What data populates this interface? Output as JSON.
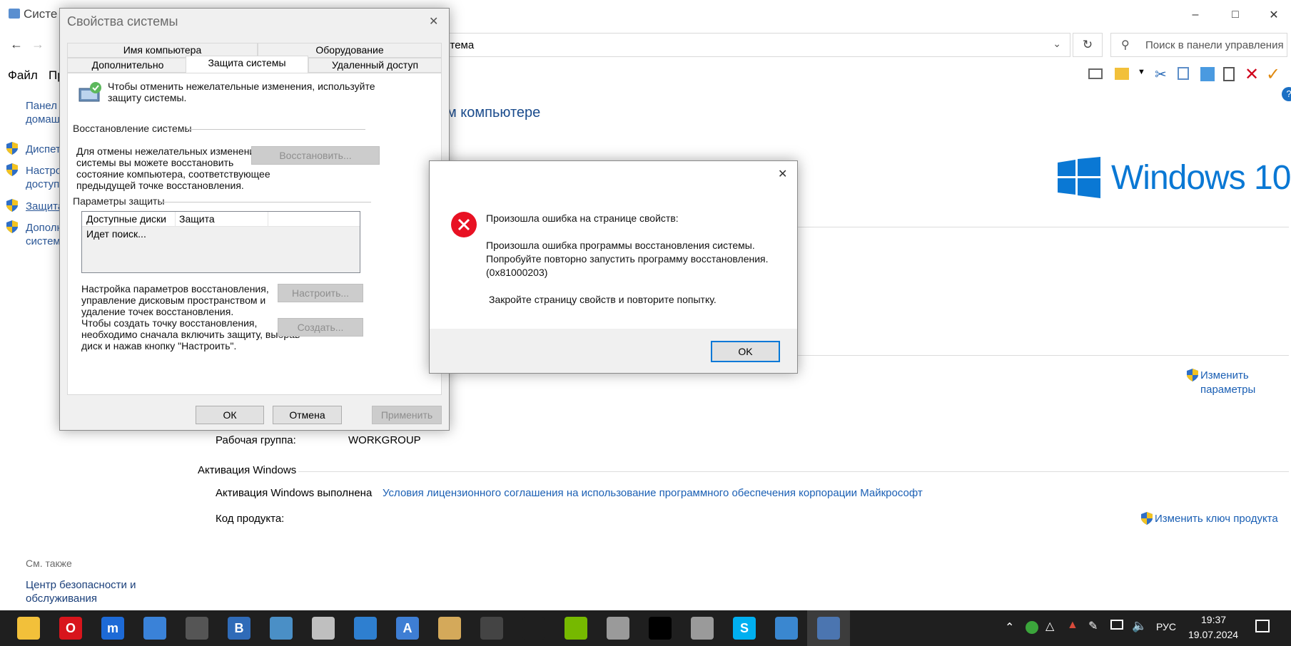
{
  "bgwin": {
    "title": "Систе",
    "address_text": "стема",
    "search_placeholder": "Поиск в панели управления",
    "menu": [
      "Файл",
      "Пр"
    ],
    "heading": "м компьютере",
    "sidebar": [
      {
        "label": "Панел\nдомаш",
        "shield": false
      },
      {
        "label": "Диспет",
        "shield": true
      },
      {
        "label": "Настро\nдоступа",
        "shield": true
      },
      {
        "label": "Защита",
        "shield": true,
        "underline": true
      },
      {
        "label": "Дополн\nсистем",
        "shield": true
      }
    ],
    "see_also": "См. также",
    "security_center": "Центр безопасности и\nобслуживания",
    "windows_logo_text": "Windows 10",
    "workgroup_label": "Рабочая группа:",
    "workgroup_value": "WORKGROUP",
    "change_params": "Изменить\nпараметры",
    "activation_title": "Активация Windows",
    "activation_status": "Активация Windows выполнена",
    "license_link": "Условия лицензионного соглашения на использование программного обеспечения корпорации Майкрософт",
    "product_key_label": "Код продукта:",
    "change_key": "Изменить ключ продукта"
  },
  "sysdlg": {
    "title": "Свойства системы",
    "tabs_top": [
      "Имя компьютера",
      "Оборудование"
    ],
    "tabs_bottom": [
      "Дополнительно",
      "Защита системы",
      "Удаленный доступ"
    ],
    "intro": "Чтобы отменить нежелательные изменения, используйте\nзащиту системы.",
    "restore_section": "Восстановление системы",
    "restore_text": "Для отмены нежелательных изменений\nсистемы вы можете восстановить\nсостояние компьютера, соответствующее\nпредыдущей точке восстановления.",
    "restore_button": "Восстановить...",
    "protection_section": "Параметры защиты",
    "table_headers": [
      "Доступные диски",
      "Защита"
    ],
    "table_status": "Идет поиск...",
    "configure_text": "Настройка параметров восстановления,\nуправление дисковым пространством и\nудаление точек восстановления.",
    "configure_button": "Настроить...",
    "create_text": "Чтобы создать точку восстановления,\nнеобходимо сначала включить защиту, выбрав\nдиск и нажав кнопку \"Настроить\".",
    "create_button": "Создать...",
    "ok": "ОК",
    "cancel": "Отмена",
    "apply": "Применить"
  },
  "errdlg": {
    "line1": "Произошла ошибка на странице свойств:",
    "line2": "Произошла ошибка программы восстановления системы.",
    "line3": "Попробуйте повторно запустить программу восстановления.",
    "line4": "(0x81000203)",
    "line5": "Закройте страницу свойств и повторите попытку.",
    "ok": "OK"
  },
  "taskbar": {
    "lang": "РУС",
    "time": "19:37",
    "date": "19.07.2024",
    "icons": [
      {
        "name": "file-explorer-icon",
        "color": "#f2c03a",
        "glyph": ""
      },
      {
        "name": "opera-icon",
        "color": "#d8151c",
        "glyph": "O"
      },
      {
        "name": "maxthon-icon",
        "color": "#1d6ad6",
        "glyph": "m"
      },
      {
        "name": "globe-icon",
        "color": "#3a82d8",
        "glyph": ""
      },
      {
        "name": "mpc-icon",
        "color": "#555555",
        "glyph": ""
      },
      {
        "name": "vk-browser-icon",
        "color": "#2f6bb8",
        "glyph": "B"
      },
      {
        "name": "book-app-icon",
        "color": "#4a8fc6",
        "glyph": ""
      },
      {
        "name": "notepad-icon",
        "color": "#bfbfbf",
        "glyph": ""
      },
      {
        "name": "notebook-icon",
        "color": "#2e7fd0",
        "glyph": ""
      },
      {
        "name": "wordpad-icon",
        "color": "#3e7ed4",
        "glyph": "A"
      },
      {
        "name": "paint-icon",
        "color": "#d4a95a",
        "glyph": ""
      },
      {
        "name": "calculator-icon",
        "color": "#444444",
        "glyph": ""
      },
      {
        "name": "circle-app-icon",
        "color": "#1f1f1f",
        "glyph": ""
      },
      {
        "name": "nvidia-icon",
        "color": "#76b900",
        "glyph": ""
      },
      {
        "name": "monitor-app-icon",
        "color": "#9a9a9a",
        "glyph": ""
      },
      {
        "name": "cmd-icon",
        "color": "#000000",
        "glyph": ""
      },
      {
        "name": "chat-icon",
        "color": "#9a9a9a",
        "glyph": ""
      },
      {
        "name": "skype-icon",
        "color": "#00aff0",
        "glyph": "S"
      },
      {
        "name": "control-panel-icon",
        "color": "#3a87d0",
        "glyph": ""
      },
      {
        "name": "system-properties-icon",
        "color": "#4b75b0",
        "glyph": ""
      }
    ]
  }
}
